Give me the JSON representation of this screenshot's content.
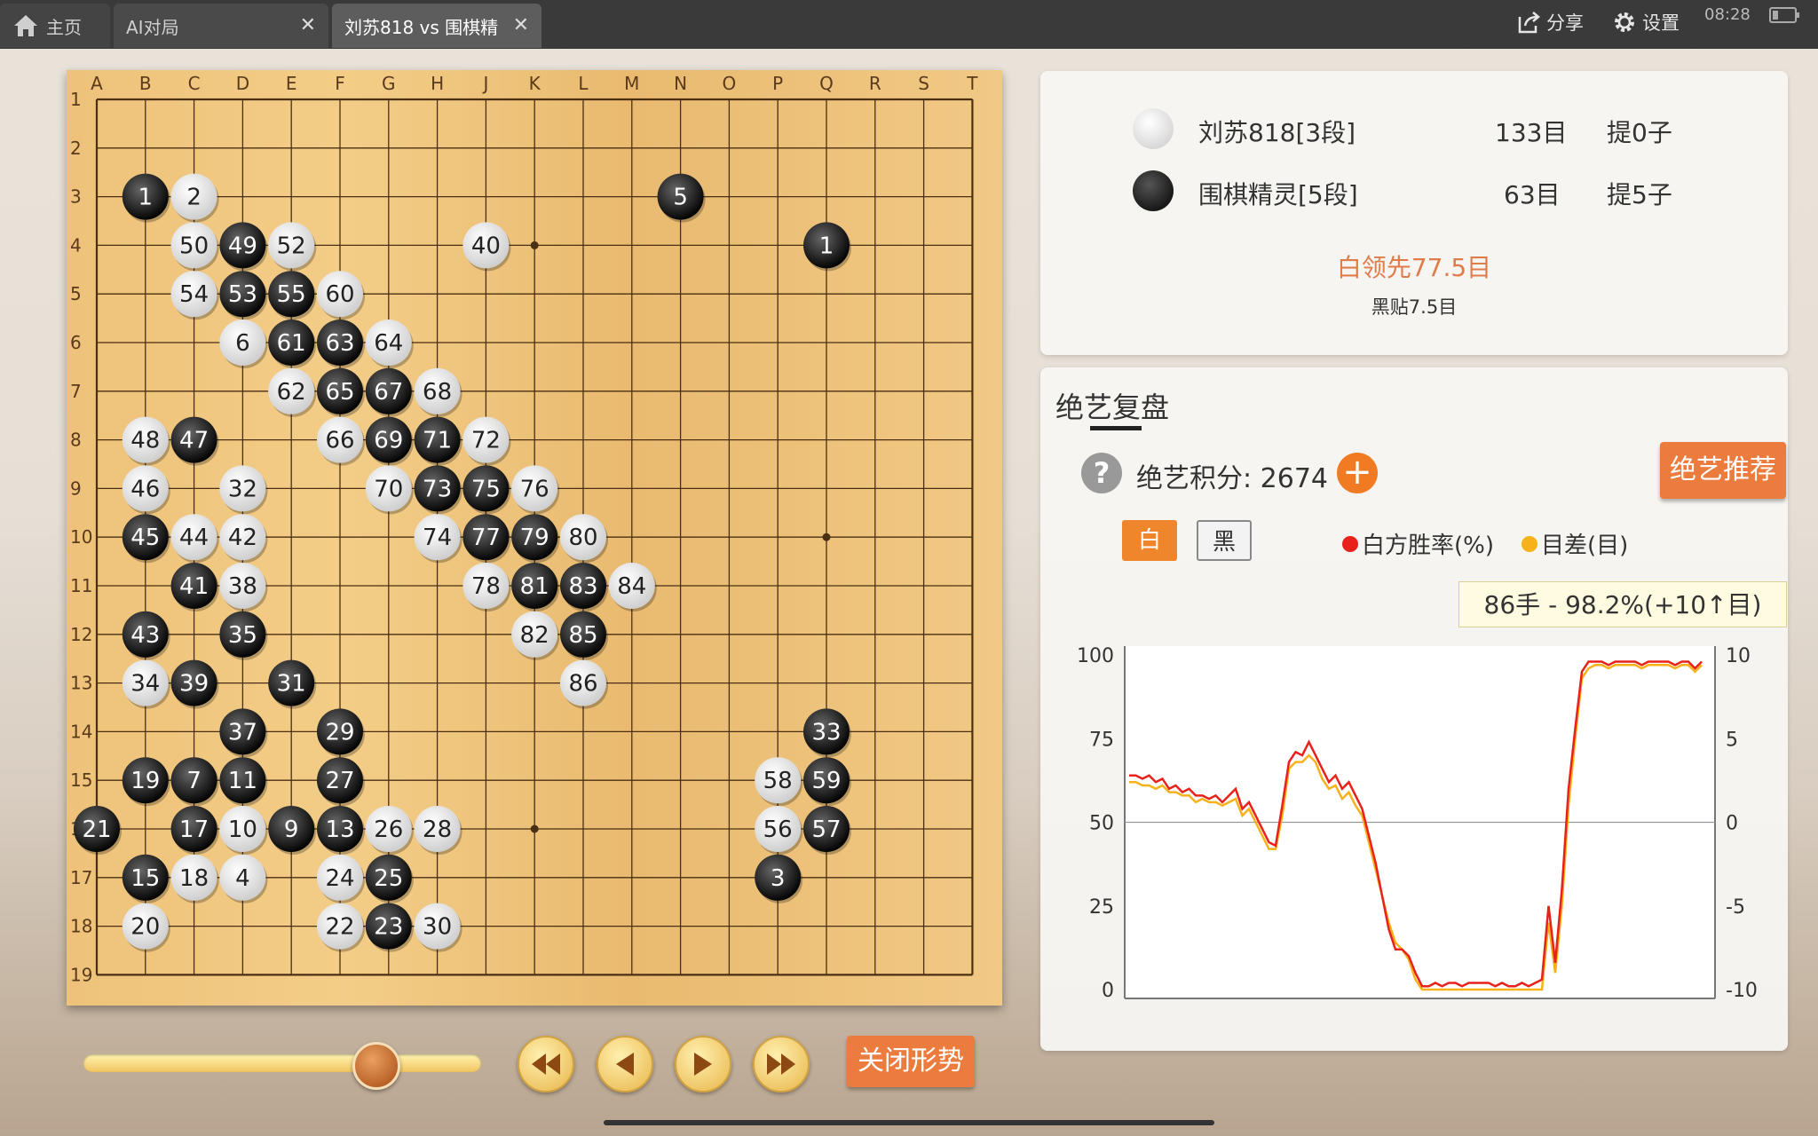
{
  "tabs": [
    {
      "label": "主页",
      "icon": "home-icon"
    },
    {
      "label": "AI对局"
    },
    {
      "label": "刘苏818 vs 围棋精"
    }
  ],
  "toolbar": {
    "share_label": "分享",
    "settings_label": "设置"
  },
  "status": {
    "time": "08:28"
  },
  "board": {
    "columns": [
      "A",
      "B",
      "C",
      "D",
      "E",
      "F",
      "G",
      "H",
      "J",
      "K",
      "L",
      "M",
      "N",
      "O",
      "P",
      "Q",
      "R",
      "S",
      "T"
    ],
    "rows": [
      "1",
      "2",
      "3",
      "4",
      "5",
      "6",
      "7",
      "8",
      "9",
      "10",
      "11",
      "12",
      "13",
      "14",
      "15",
      "16",
      "17",
      "18",
      "19"
    ],
    "stones": [
      {
        "c": "B",
        "r": 3,
        "color": "black",
        "label": "1"
      },
      {
        "c": "C",
        "r": 3,
        "color": "white",
        "label": "2"
      },
      {
        "c": "C",
        "r": 4,
        "color": "white",
        "label": "50"
      },
      {
        "c": "D",
        "r": 4,
        "color": "black",
        "label": "49"
      },
      {
        "c": "E",
        "r": 4,
        "color": "white",
        "label": "52"
      },
      {
        "c": "C",
        "r": 5,
        "color": "white",
        "label": "54"
      },
      {
        "c": "D",
        "r": 5,
        "color": "black",
        "label": "53"
      },
      {
        "c": "E",
        "r": 5,
        "color": "black",
        "label": "55"
      },
      {
        "c": "F",
        "r": 5,
        "color": "white",
        "label": "60"
      },
      {
        "c": "D",
        "r": 6,
        "color": "white",
        "label": "6"
      },
      {
        "c": "E",
        "r": 6,
        "color": "black",
        "label": "61"
      },
      {
        "c": "F",
        "r": 6,
        "color": "black",
        "label": "63"
      },
      {
        "c": "G",
        "r": 6,
        "color": "white",
        "label": "64"
      },
      {
        "c": "E",
        "r": 7,
        "color": "white",
        "label": "62"
      },
      {
        "c": "F",
        "r": 7,
        "color": "black",
        "label": "65"
      },
      {
        "c": "G",
        "r": 7,
        "color": "black",
        "label": "67"
      },
      {
        "c": "H",
        "r": 7,
        "color": "white",
        "label": "68"
      },
      {
        "c": "B",
        "r": 8,
        "color": "white",
        "label": "48"
      },
      {
        "c": "C",
        "r": 8,
        "color": "black",
        "label": "47"
      },
      {
        "c": "F",
        "r": 8,
        "color": "white",
        "label": "66"
      },
      {
        "c": "G",
        "r": 8,
        "color": "black",
        "label": "69"
      },
      {
        "c": "H",
        "r": 8,
        "color": "black",
        "label": "71"
      },
      {
        "c": "J",
        "r": 8,
        "color": "white",
        "label": "72"
      },
      {
        "c": "B",
        "r": 9,
        "color": "white",
        "label": "46"
      },
      {
        "c": "D",
        "r": 9,
        "color": "white",
        "label": "32"
      },
      {
        "c": "G",
        "r": 9,
        "color": "white",
        "label": "70"
      },
      {
        "c": "H",
        "r": 9,
        "color": "black",
        "label": "73"
      },
      {
        "c": "J",
        "r": 9,
        "color": "black",
        "label": "75"
      },
      {
        "c": "K",
        "r": 9,
        "color": "white",
        "label": "76"
      },
      {
        "c": "B",
        "r": 10,
        "color": "black",
        "label": "45"
      },
      {
        "c": "C",
        "r": 10,
        "color": "white",
        "label": "44"
      },
      {
        "c": "D",
        "r": 10,
        "color": "white",
        "label": "42"
      },
      {
        "c": "H",
        "r": 10,
        "color": "white",
        "label": "74"
      },
      {
        "c": "J",
        "r": 10,
        "color": "black",
        "label": "77"
      },
      {
        "c": "K",
        "r": 10,
        "color": "black",
        "label": "79"
      },
      {
        "c": "L",
        "r": 10,
        "color": "white",
        "label": "80"
      },
      {
        "c": "C",
        "r": 11,
        "color": "black",
        "label": "41"
      },
      {
        "c": "D",
        "r": 11,
        "color": "white",
        "label": "38"
      },
      {
        "c": "J",
        "r": 11,
        "color": "white",
        "label": "78"
      },
      {
        "c": "K",
        "r": 11,
        "color": "black",
        "label": "81"
      },
      {
        "c": "L",
        "r": 11,
        "color": "black",
        "label": "83"
      },
      {
        "c": "M",
        "r": 11,
        "color": "white",
        "label": "84"
      },
      {
        "c": "B",
        "r": 12,
        "color": "black",
        "label": "43"
      },
      {
        "c": "D",
        "r": 12,
        "color": "black",
        "label": "35"
      },
      {
        "c": "K",
        "r": 12,
        "color": "white",
        "label": "82"
      },
      {
        "c": "L",
        "r": 12,
        "color": "black",
        "label": "85"
      },
      {
        "c": "B",
        "r": 13,
        "color": "white",
        "label": "34"
      },
      {
        "c": "C",
        "r": 13,
        "color": "black",
        "label": "39"
      },
      {
        "c": "E",
        "r": 13,
        "color": "black",
        "label": "31"
      },
      {
        "c": "L",
        "r": 13,
        "color": "white",
        "label": "86"
      },
      {
        "c": "D",
        "r": 14,
        "color": "black",
        "label": "37"
      },
      {
        "c": "F",
        "r": 14,
        "color": "black",
        "label": "29"
      },
      {
        "c": "Q",
        "r": 14,
        "color": "black",
        "label": "33"
      },
      {
        "c": "B",
        "r": 15,
        "color": "black",
        "label": "19"
      },
      {
        "c": "C",
        "r": 15,
        "color": "black",
        "label": "7"
      },
      {
        "c": "D",
        "r": 15,
        "color": "black",
        "label": "11"
      },
      {
        "c": "F",
        "r": 15,
        "color": "black",
        "label": "27"
      },
      {
        "c": "P",
        "r": 15,
        "color": "white",
        "label": "58"
      },
      {
        "c": "Q",
        "r": 15,
        "color": "black",
        "label": "59"
      },
      {
        "c": "A",
        "r": 16,
        "color": "black",
        "label": "21"
      },
      {
        "c": "C",
        "r": 16,
        "color": "black",
        "label": "17"
      },
      {
        "c": "D",
        "r": 16,
        "color": "white",
        "label": "10"
      },
      {
        "c": "E",
        "r": 16,
        "color": "black",
        "label": "9"
      },
      {
        "c": "F",
        "r": 16,
        "color": "black",
        "label": "13"
      },
      {
        "c": "G",
        "r": 16,
        "color": "white",
        "label": "26"
      },
      {
        "c": "H",
        "r": 16,
        "color": "white",
        "label": "28"
      },
      {
        "c": "P",
        "r": 16,
        "color": "white",
        "label": "56"
      },
      {
        "c": "Q",
        "r": 16,
        "color": "black",
        "label": "57"
      },
      {
        "c": "B",
        "r": 17,
        "color": "black",
        "label": "15"
      },
      {
        "c": "C",
        "r": 17,
        "color": "white",
        "label": "18"
      },
      {
        "c": "D",
        "r": 17,
        "color": "white",
        "label": "4"
      },
      {
        "c": "F",
        "r": 17,
        "color": "white",
        "label": "24"
      },
      {
        "c": "G",
        "r": 17,
        "color": "black",
        "label": "25"
      },
      {
        "c": "P",
        "r": 17,
        "color": "black",
        "label": "3"
      },
      {
        "c": "B",
        "r": 18,
        "color": "white",
        "label": "20"
      },
      {
        "c": "F",
        "r": 18,
        "color": "white",
        "label": "22"
      },
      {
        "c": "G",
        "r": 18,
        "color": "black",
        "label": "23"
      },
      {
        "c": "H",
        "r": 18,
        "color": "white",
        "label": "30"
      },
      {
        "c": "N",
        "r": 3,
        "color": "black",
        "label": "5"
      },
      {
        "c": "Q",
        "r": 4,
        "color": "black",
        "label": "1"
      },
      {
        "c": "J",
        "r": 4,
        "color": "white",
        "label": "40"
      }
    ]
  },
  "players": [
    {
      "name": "刘苏818[3段]",
      "score": "133目",
      "captures": "提0子",
      "stone": "white"
    },
    {
      "name": "围棋精灵[5段]",
      "score": "63目",
      "captures": "提5子",
      "stone": "black"
    }
  ],
  "lead_text": "白领先77.5目",
  "komi_text": "黑贴7.5目",
  "analysis": {
    "title": "绝艺复盘",
    "score_label": "绝艺积分: 2674",
    "recommend_label": "绝艺推荐",
    "color_white": "白",
    "color_black": "黑",
    "legend_winrate": "白方胜率(%)",
    "legend_diff": "目差(目)",
    "tooltip": "86手 - 98.2%(+10↑目)"
  },
  "chart_data": {
    "type": "line",
    "yleft_ticks": [
      "100",
      "75",
      "50",
      "25",
      "0"
    ],
    "yright_ticks": [
      "10",
      "5",
      "0",
      "-5",
      "-10"
    ],
    "ylim": [
      0,
      100
    ],
    "y2lim": [
      -10,
      10
    ],
    "xlim": [
      0,
      86
    ],
    "series": [
      {
        "name": "白方胜率(%)",
        "color": "#e8221a",
        "values": [
          64,
          64,
          63,
          64,
          62,
          63,
          60,
          61,
          59,
          60,
          58,
          58,
          57,
          58,
          56,
          58,
          60,
          54,
          56,
          52,
          48,
          44,
          43,
          55,
          68,
          71,
          70,
          74,
          70,
          66,
          62,
          64,
          60,
          62,
          58,
          54,
          46,
          38,
          28,
          18,
          12,
          12,
          10,
          5,
          1,
          1,
          2,
          1,
          2,
          2,
          1,
          2,
          2,
          2,
          2,
          1,
          2,
          1,
          1,
          2,
          1,
          2,
          3,
          25,
          8,
          30,
          60,
          78,
          95,
          98,
          98,
          98,
          97,
          98,
          98,
          98,
          98,
          97,
          98,
          98,
          98,
          98,
          97,
          98,
          98,
          96,
          98
        ]
      },
      {
        "name": "目差(目)",
        "color": "#f7b21a",
        "values": [
          62,
          62,
          61,
          61,
          60,
          61,
          59,
          59,
          58,
          58,
          56,
          57,
          56,
          56,
          55,
          56,
          57,
          52,
          54,
          50,
          46,
          42,
          42,
          52,
          66,
          68,
          68,
          70,
          68,
          63,
          60,
          61,
          57,
          59,
          55,
          52,
          44,
          36,
          28,
          20,
          14,
          12,
          9,
          3,
          0,
          0,
          0,
          0,
          0,
          0,
          0,
          0,
          0,
          0,
          0,
          0,
          0,
          0,
          0,
          0,
          0,
          0,
          0,
          20,
          5,
          25,
          55,
          75,
          93,
          96,
          97,
          97,
          96,
          97,
          97,
          97,
          97,
          96,
          97,
          97,
          97,
          97,
          96,
          97,
          97,
          95,
          97
        ]
      }
    ]
  },
  "controls": {
    "slider_progress": 0.73,
    "close_label": "关闭形势"
  }
}
